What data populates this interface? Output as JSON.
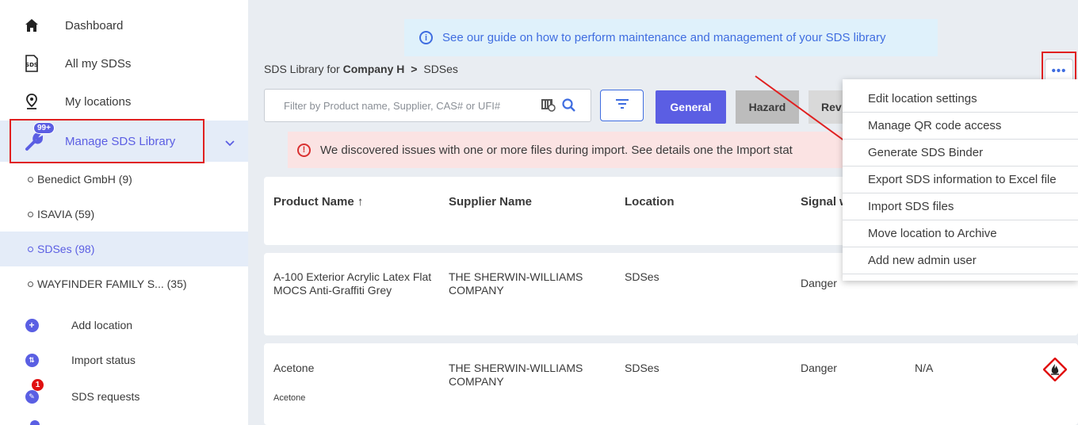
{
  "sidebar": {
    "items": [
      {
        "label": "Dashboard",
        "icon": "home-icon"
      },
      {
        "label": "All my SDSs",
        "icon": "sds-icon"
      },
      {
        "label": "My locations",
        "icon": "location-pin-icon"
      },
      {
        "label": "Manage SDS Library",
        "icon": "wrench-icon",
        "badge": "99+"
      }
    ],
    "sub_items": [
      {
        "label": "Benedict GmbH (9)"
      },
      {
        "label": "ISAVIA (59)"
      },
      {
        "label": "SDSes (98)"
      },
      {
        "label": "WAYFINDER FAMILY S... (35)"
      }
    ],
    "actions": [
      {
        "label": "Add location",
        "icon": "plus-icon"
      },
      {
        "label": "Import status",
        "icon": "import-icon"
      },
      {
        "label": "SDS requests",
        "icon": "request-icon",
        "badge": "1"
      }
    ]
  },
  "info_banner": {
    "text": "See our guide on how to perform maintenance and management of your SDS library"
  },
  "breadcrumb": {
    "prefix": "SDS Library for",
    "company": "Company H",
    "separator": ">",
    "current": "SDSes"
  },
  "filter": {
    "placeholder": "Filter by Product name, Supplier, CAS# or UFI#"
  },
  "tabs": {
    "general": "General",
    "hazard": "Hazard",
    "rev": "Rev"
  },
  "warning": {
    "text": "We discovered issues with one or more files during import. See details one the Import stat"
  },
  "table": {
    "headers": {
      "product": "Product Name",
      "sort_arrow": "↑",
      "supplier": "Supplier Name",
      "location": "Location",
      "signal": "Signal w"
    },
    "rows": [
      {
        "product": "A-100 Exterior Acrylic Latex Flat MOCS Anti-Graffiti Grey",
        "supplier": "THE SHERWIN-WILLIAMS COMPANY",
        "location": "SDSes",
        "signal": "Danger"
      },
      {
        "product": "Acetone",
        "product_sub": "Acetone",
        "supplier": "THE SHERWIN-WILLIAMS COMPANY",
        "location": "SDSes",
        "signal": "Danger",
        "extra": "N/A"
      }
    ]
  },
  "more_button": {
    "label": "•••"
  },
  "dropdown": {
    "items": [
      "Edit location settings",
      "Manage QR code access",
      "Generate SDS Binder",
      "Export SDS information to Excel file",
      "Import SDS files",
      "Move location to Archive",
      "Add new admin user"
    ]
  },
  "colors": {
    "accent": "#5b5ee3",
    "highlight": "#e02020",
    "active_bg": "#e4ecf8"
  }
}
